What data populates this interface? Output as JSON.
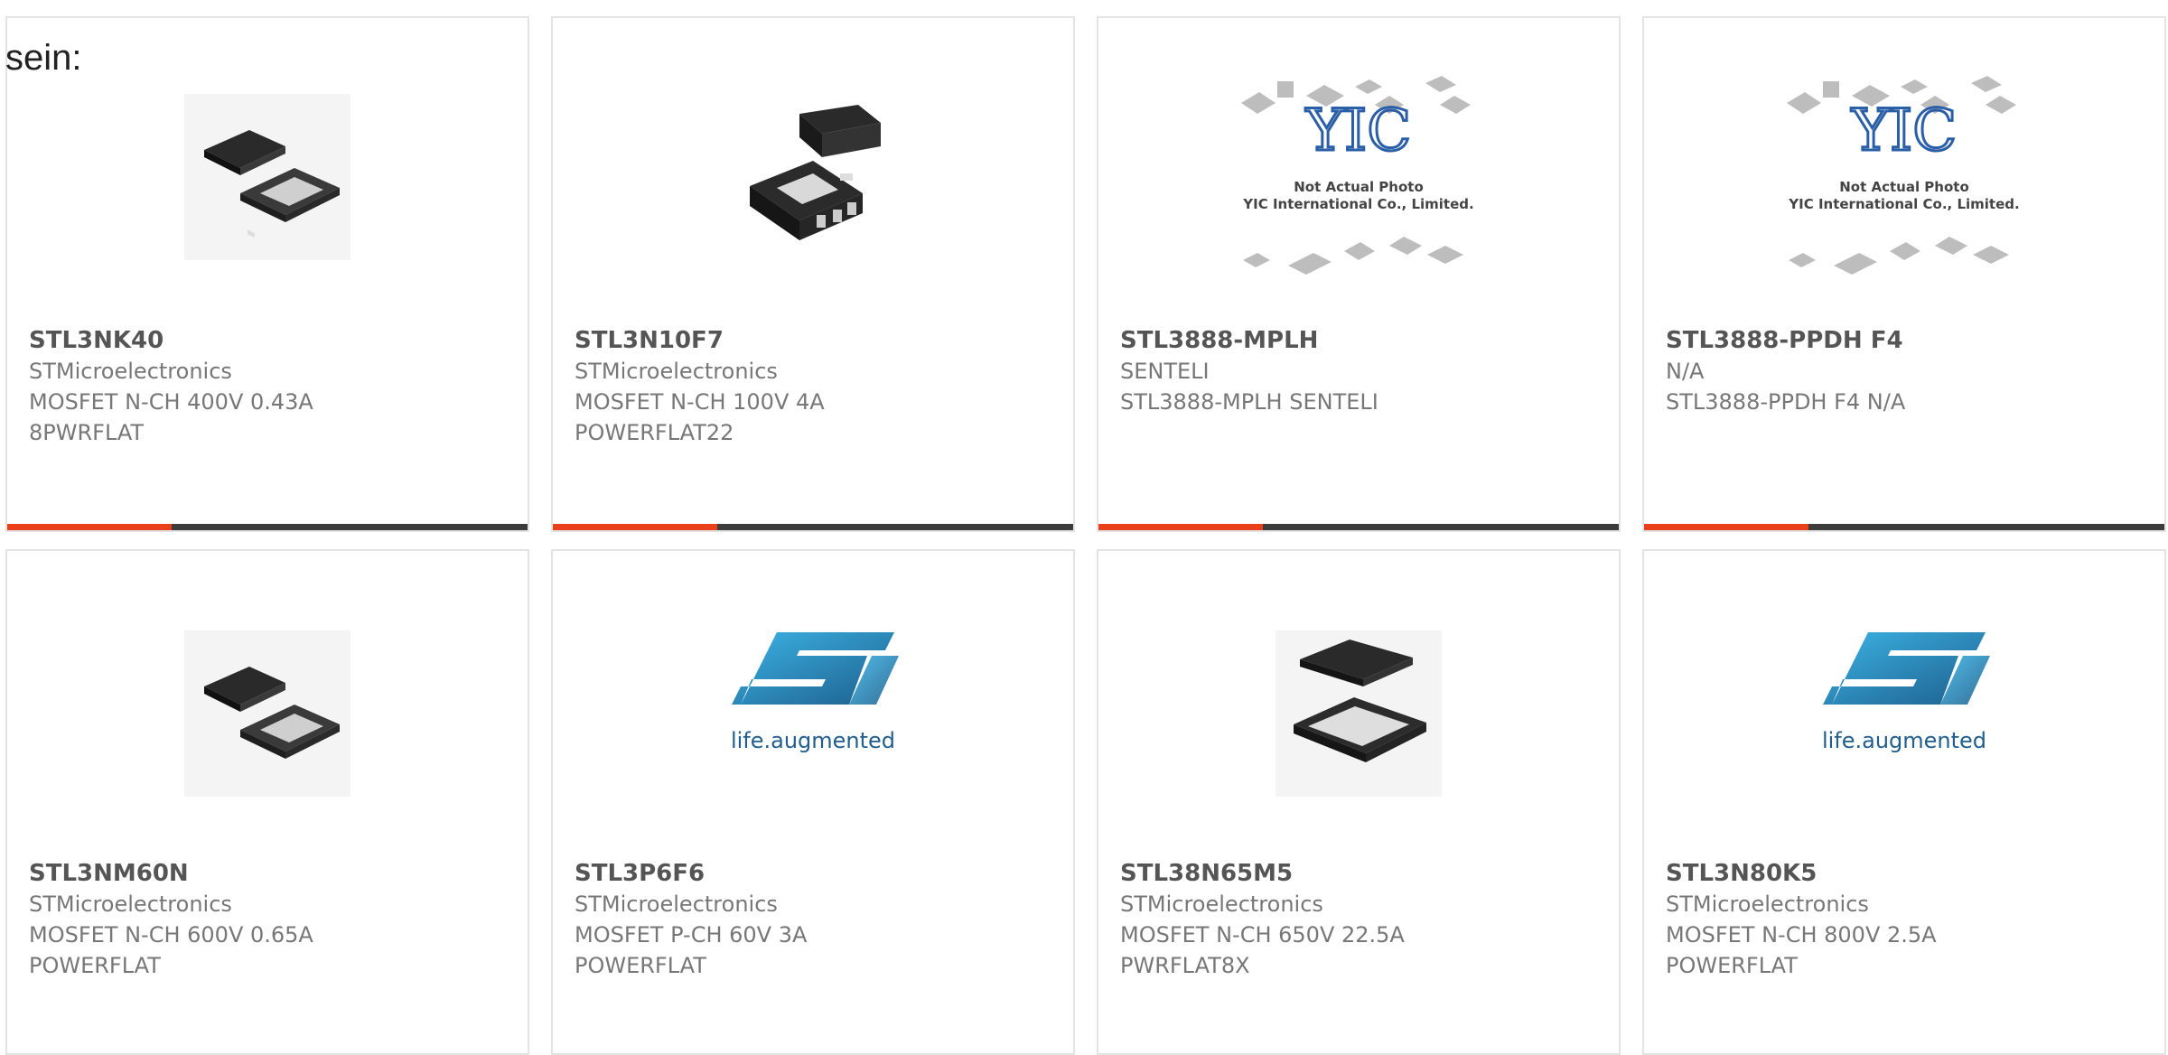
{
  "intro_text": "sein:",
  "accent_color": "#e8401a",
  "bar_color": "#3c3c3c",
  "products": [
    {
      "part": "STL3NK40",
      "manufacturer": "STMicroelectronics",
      "lines": [
        "MOSFET N-CH 400V 0.43A",
        "8PWRFLAT"
      ],
      "image": "package-open-icon"
    },
    {
      "part": "STL3N10F7",
      "manufacturer": "STMicroelectronics",
      "lines": [
        "MOSFET N-CH 100V 4A",
        "POWERFLAT22"
      ],
      "image": "package-small-icon"
    },
    {
      "part": "STL3888-MPLH",
      "manufacturer": "SENTELI",
      "lines": [
        "STL3888-MPLH SENTELI",
        ""
      ],
      "image": "yic-placeholder",
      "placeholder_text": [
        "Not Actual Photo",
        "YIC International Co., Limited."
      ]
    },
    {
      "part": "STL3888-PPDH F4",
      "manufacturer": "N/A",
      "lines": [
        "STL3888-PPDH F4 N/A",
        ""
      ],
      "image": "yic-placeholder",
      "placeholder_text": [
        "Not Actual Photo",
        "YIC International Co., Limited."
      ]
    },
    {
      "part": "STL3NM60N",
      "manufacturer": "STMicroelectronics",
      "lines": [
        "MOSFET N-CH 600V 0.65A",
        "POWERFLAT"
      ],
      "image": "package-open-icon"
    },
    {
      "part": "STL3P6F6",
      "manufacturer": "STMicroelectronics",
      "lines": [
        "MOSFET P-CH 60V 3A",
        "POWERFLAT"
      ],
      "image": "st-logo",
      "logo_text": "life.augmented"
    },
    {
      "part": "STL38N65M5",
      "manufacturer": "STMicroelectronics",
      "lines": [
        "MOSFET N-CH 650V 22.5A",
        "PWRFLAT8X"
      ],
      "image": "package-large-icon"
    },
    {
      "part": "STL3N80K5",
      "manufacturer": "STMicroelectronics",
      "lines": [
        "MOSFET N-CH 800V 2.5A",
        "POWERFLAT"
      ],
      "image": "st-logo",
      "logo_text": "life.augmented"
    }
  ]
}
